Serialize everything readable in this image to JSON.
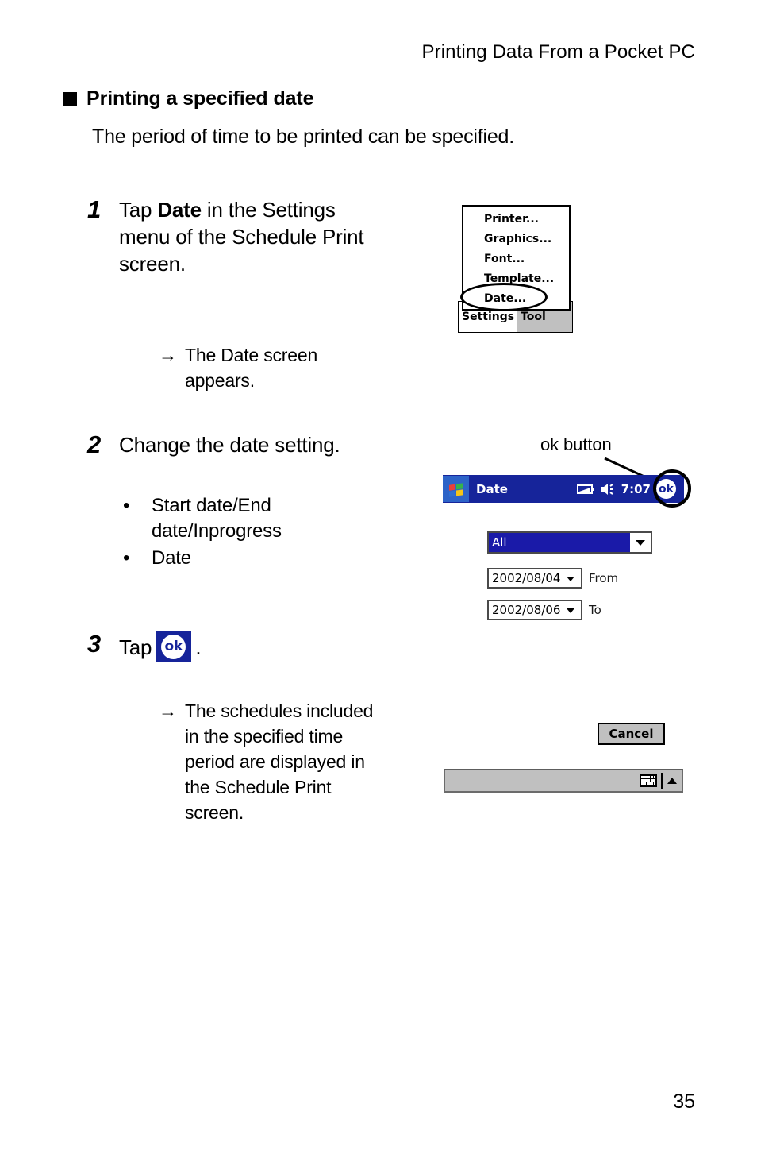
{
  "page": {
    "running_head": "Printing Data From a Pocket PC",
    "page_number": "35"
  },
  "section": {
    "heading": "Printing a specified date",
    "intro": "The period of time to be printed can be specified."
  },
  "steps": [
    {
      "number": "1",
      "text_before": "Tap ",
      "text_bold": "Date",
      "text_after": " in the Settings menu of the Schedule Print screen.",
      "result_arrow": "→",
      "result": "The Date screen appears."
    },
    {
      "number": "2",
      "text": "Change the date setting.",
      "bullets": [
        "Start date/End date/Inprogress",
        "Date"
      ]
    },
    {
      "number": "3",
      "text_before": "Tap",
      "text_after": ".",
      "icon": "ok-icon",
      "result_arrow": "→",
      "result": "The schedules included in the specified time period are displayed in the Schedule Print screen."
    }
  ],
  "menu_screenshot": {
    "items": [
      "Printer...",
      "Graphics...",
      "Font...",
      "Template...",
      "Date..."
    ],
    "highlighted_item": "Date...",
    "tabs": [
      {
        "label": "Settings",
        "active": true
      },
      {
        "label": "Tool",
        "active": false
      }
    ]
  },
  "pda_screen": {
    "callout_label": "ok button",
    "titlebar": {
      "start_icon": "windows-flag-icon",
      "title": "Date",
      "battery_icon": "battery-icon",
      "speaker_icon": "speaker-icon",
      "clock": "7:07",
      "ok_button": "ok"
    },
    "fields": {
      "range_mode": {
        "value": "All",
        "selected": true
      },
      "from": {
        "value": "2002/08/04",
        "label": "From"
      },
      "to": {
        "value": "2002/08/06",
        "label": "To"
      }
    },
    "cancel_label": "Cancel",
    "sip_bar": {
      "keyboard_icon": "keyboard-icon",
      "expand_icon": "triangle-up-icon"
    }
  },
  "colors": {
    "titlebar_blue": "#16249a",
    "start_blue": "#2d63c8",
    "selection_blue": "#1a1aa8",
    "chrome_gray": "#c0c0c0"
  }
}
